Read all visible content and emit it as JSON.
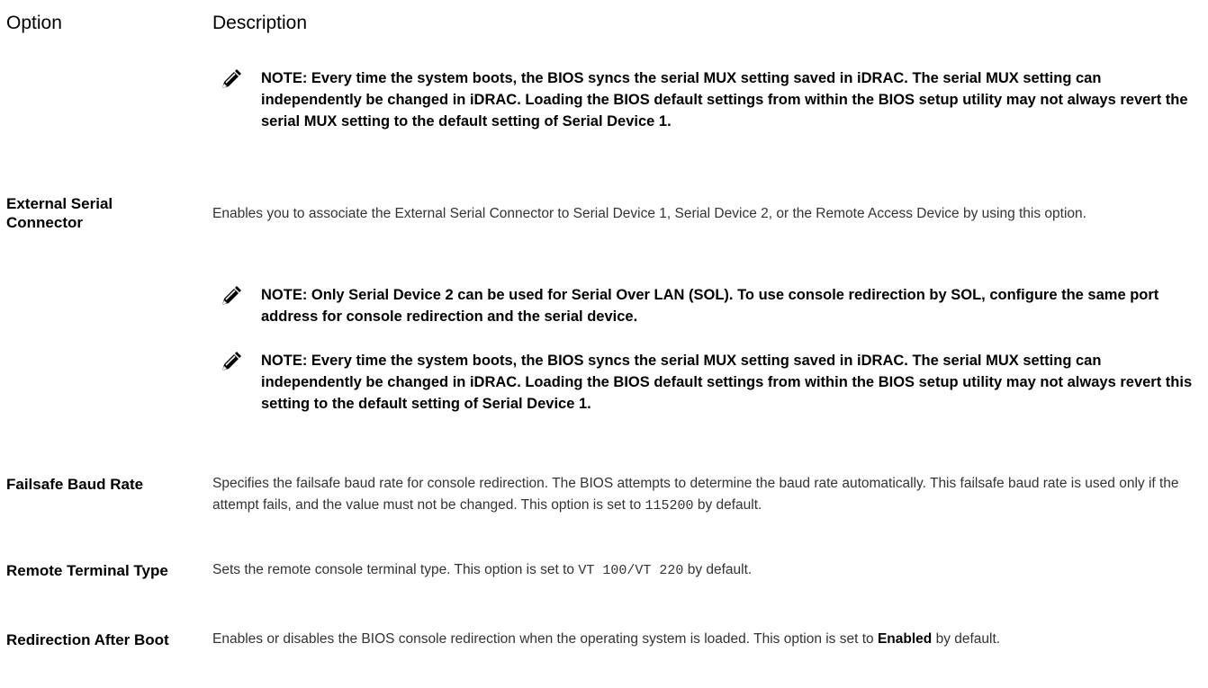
{
  "header": {
    "option": "Option",
    "description": "Description"
  },
  "notes": {
    "top": "NOTE: Every time the system boots, the BIOS syncs the serial MUX setting saved in iDRAC. The serial MUX setting can independently be changed in iDRAC. Loading the BIOS default settings from within the BIOS setup utility may not always revert the serial MUX setting to the default setting of Serial Device 1.",
    "sol": "NOTE: Only Serial Device 2 can be used for Serial Over LAN (SOL). To use console redirection by SOL, configure the same port address for console redirection and the serial device.",
    "mux": "NOTE: Every time the system boots, the BIOS syncs the serial MUX setting saved in iDRAC. The serial MUX setting can independently be changed in iDRAC. Loading the BIOS default settings from within the BIOS setup utility may not always revert this setting to the default setting of Serial Device 1.",
    "icon": "note-pencil-icon"
  },
  "rows": {
    "external_serial": {
      "label": "External Serial Connector",
      "description": "Enables you to associate the External Serial Connector to Serial Device 1, Serial Device 2, or the Remote Access Device by using this option."
    },
    "failsafe": {
      "label": "Failsafe Baud Rate",
      "description_pre": "Specifies the failsafe baud rate for console redirection. The BIOS attempts to determine the baud rate automatically. This failsafe baud rate is used only if the attempt fails, and the value must not be changed. This option is set to ",
      "value": "115200",
      "description_post": " by default."
    },
    "remote_terminal": {
      "label": "Remote Terminal Type",
      "description_pre": "Sets the remote console terminal type. This option is set to ",
      "value": "VT 100/VT 220",
      "description_post": " by default."
    },
    "redirection_after_boot": {
      "label": "Redirection After Boot",
      "description_pre": "Enables or disables the BIOS console redirection when the operating system is loaded. This option is set to ",
      "value": "Enabled",
      "description_post": " by default."
    }
  }
}
